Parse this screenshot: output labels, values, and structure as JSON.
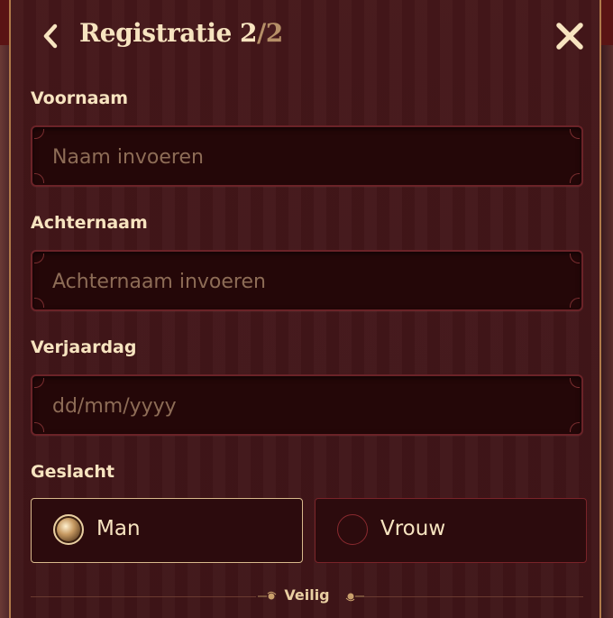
{
  "header": {
    "title": "Registratie",
    "step_current": "2",
    "step_total": "/2"
  },
  "form": {
    "first_name": {
      "label": "Voornaam",
      "placeholder": "Naam invoeren",
      "value": ""
    },
    "last_name": {
      "label": "Achternaam",
      "placeholder": "Achternaam invoeren",
      "value": ""
    },
    "birthday": {
      "label": "Verjaardag",
      "placeholder": "dd/mm/yyyy",
      "value": ""
    },
    "gender": {
      "label": "Geslacht",
      "options": [
        {
          "label": "Man",
          "selected": true
        },
        {
          "label": "Vrouw",
          "selected": false
        }
      ]
    }
  },
  "footer": {
    "secure_label": "Veilig"
  },
  "colors": {
    "panel": "#45171a",
    "field": "#240708",
    "text": "#f7e4c0",
    "accent_gold": "#d8b98c",
    "border_red": "#7a2429"
  },
  "icons": {
    "back": "chevron-left-icon",
    "close": "close-icon",
    "flourish": "ornament-icon"
  }
}
